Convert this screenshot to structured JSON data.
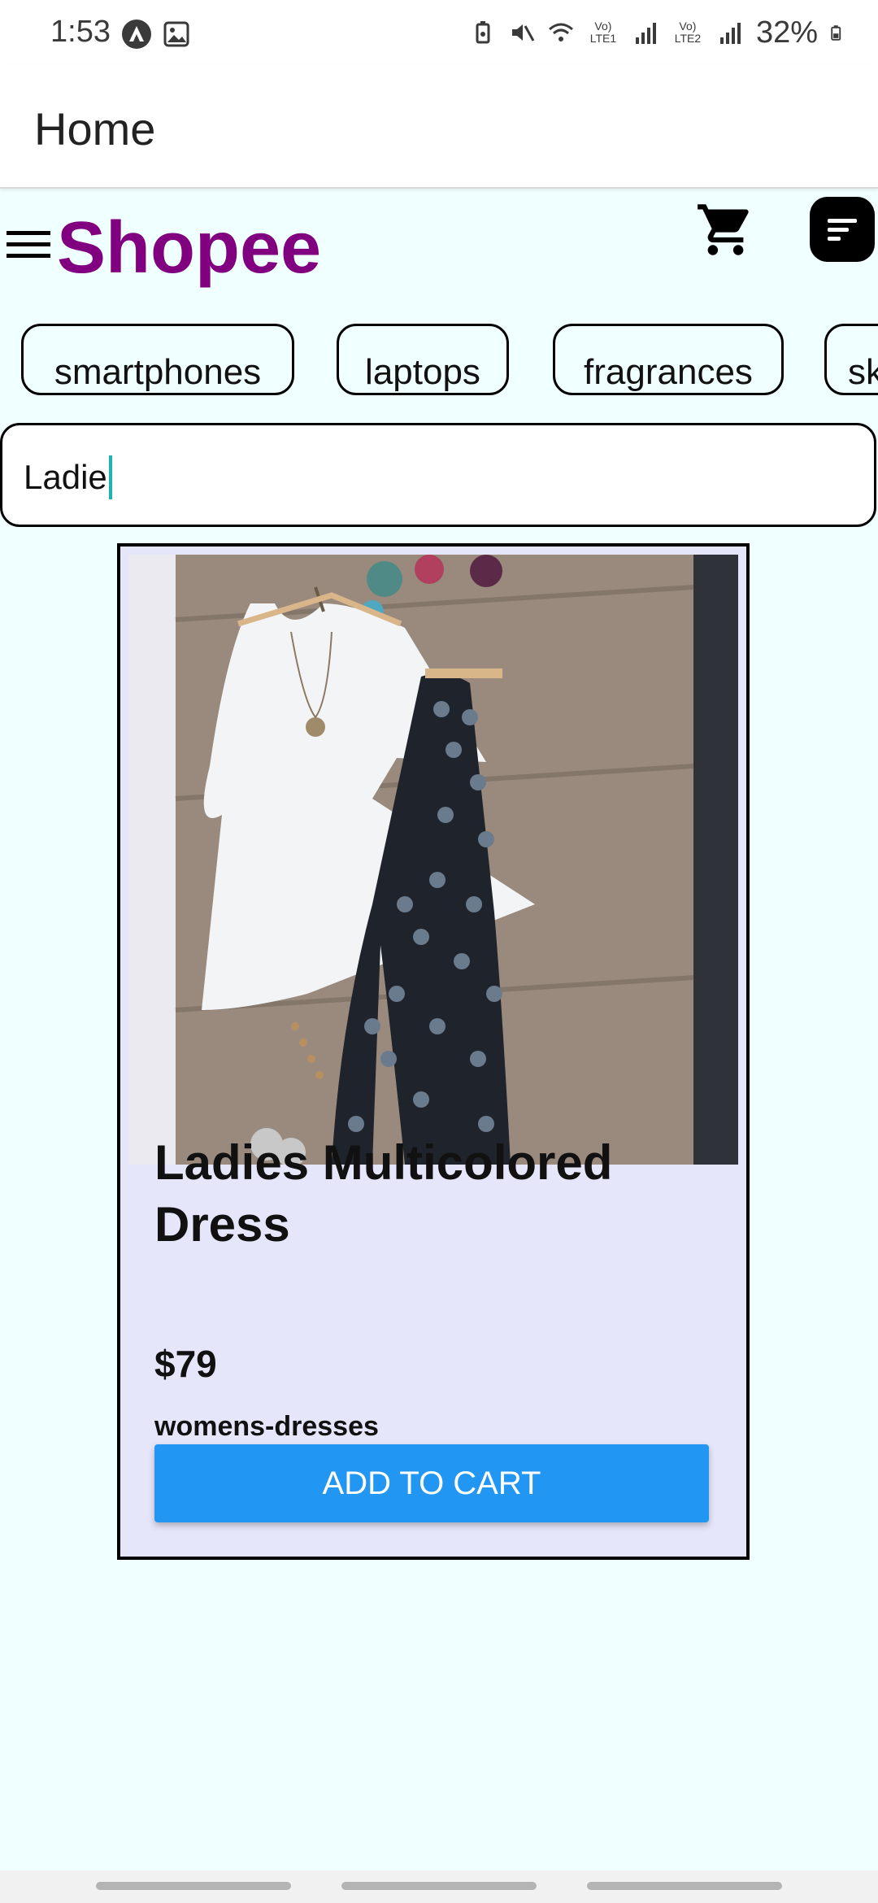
{
  "status_bar": {
    "time": "1:53",
    "signal_label_1": "Vo) LTE1",
    "signal_label_2": "Vo) LTE2",
    "battery": "32%"
  },
  "app_bar": {
    "title": "Home"
  },
  "header": {
    "brand": "Shopee",
    "brand_color": "#800080",
    "icons": [
      "menu-icon",
      "cart-icon",
      "filter-icon"
    ]
  },
  "categories": [
    {
      "label": "smartphones"
    },
    {
      "label": "laptops"
    },
    {
      "label": "fragrances"
    },
    {
      "label": "skincare"
    }
  ],
  "search": {
    "value": "Ladie"
  },
  "product": {
    "title": "Ladies Multicolored Dress",
    "price": "$79",
    "category": "womens-dresses",
    "add_to_cart_label": "ADD TO CART",
    "button_color": "#2196f3",
    "card_color": "#e6e6fa"
  }
}
